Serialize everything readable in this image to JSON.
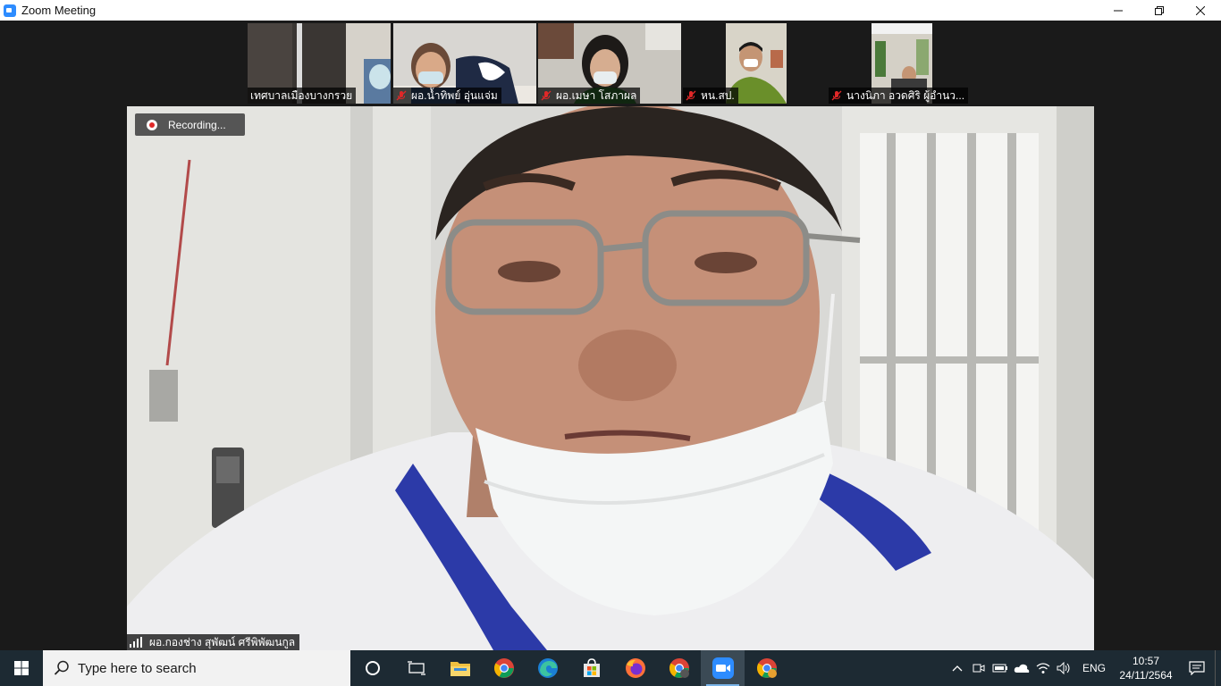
{
  "window": {
    "title": "Zoom Meeting"
  },
  "meeting": {
    "recording_label": "Recording...",
    "participants": [
      {
        "name": "เทศบาลเมืองบางกรวย",
        "muted": false
      },
      {
        "name": "ผอ.น้ำทิพย์ อุ่นแจ่ม",
        "muted": true
      },
      {
        "name": "ผอ.เมษา โสภาผล",
        "muted": true
      },
      {
        "name": "หน.สป.",
        "muted": true
      },
      {
        "name": "นางนิภา อวดศิริ ผู้อำนว...",
        "muted": true
      }
    ],
    "active_speaker": {
      "name": "ผอ.กองช่าง สุพัฒน์ ศรีพิพัฒนกูล"
    }
  },
  "taskbar": {
    "search_placeholder": "Type here to search",
    "pinned_apps": [
      "task-view-icon",
      "file-explorer-icon",
      "chrome-icon",
      "edge-icon",
      "store-icon",
      "firefox-icon",
      "chrome-profile-icon",
      "zoom-icon",
      "chrome-alt-icon"
    ],
    "tray": {
      "language": "ENG",
      "time": "10:57",
      "date": "24/11/2564"
    }
  },
  "colors": {
    "zoom_blue": "#2d8cff",
    "recording_red": "#e02828",
    "taskbar_bg": "#1d2a33",
    "mute_red": "#e02828"
  }
}
